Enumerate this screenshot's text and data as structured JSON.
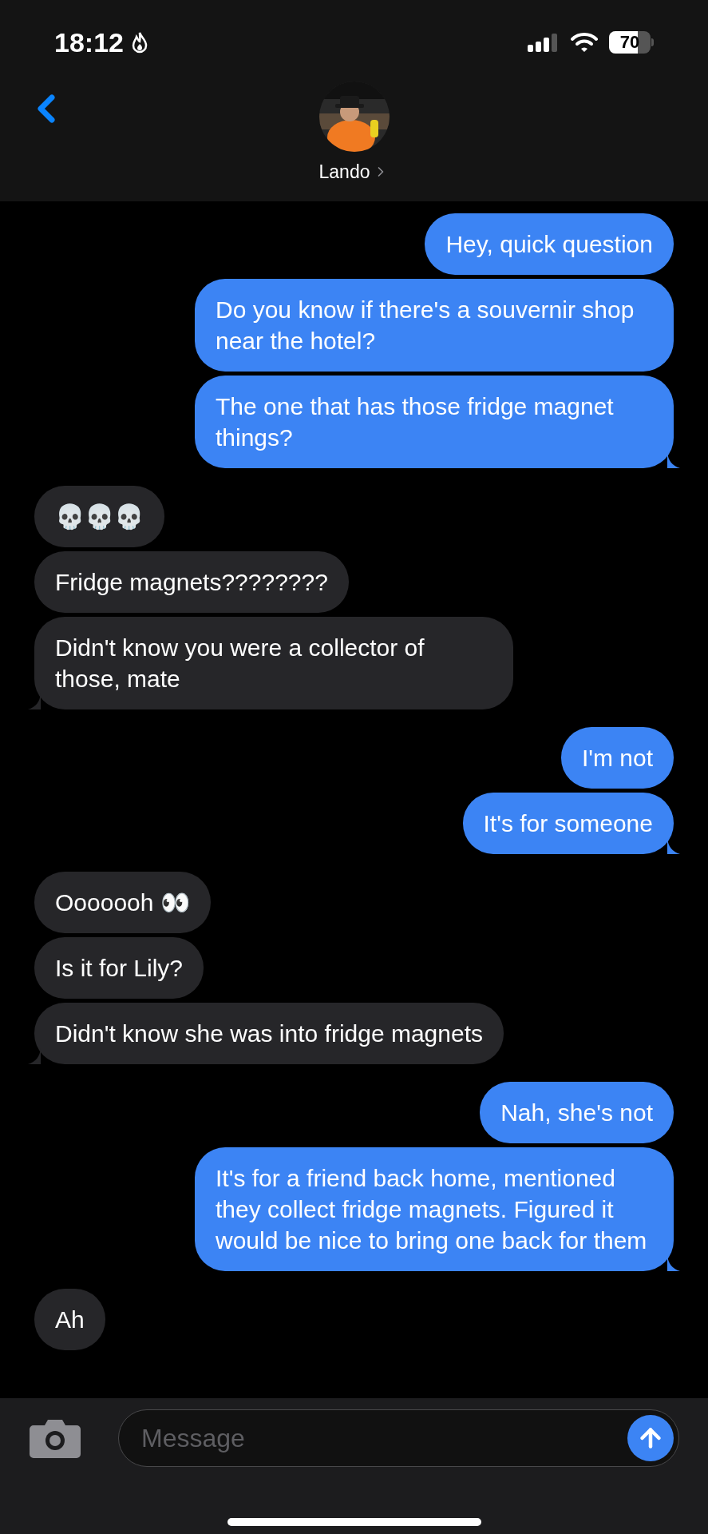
{
  "status_bar": {
    "time": "18:12",
    "battery": "70"
  },
  "header": {
    "contact_name": "Lando"
  },
  "messages": [
    {
      "kind": "sent",
      "text": "Hey, quick question"
    },
    {
      "kind": "sent",
      "text": "Do you know if there's a souvernir shop near the hotel?"
    },
    {
      "kind": "sent",
      "text": "The one that has those fridge magnet things?"
    },
    {
      "kind": "received",
      "text": "💀💀💀"
    },
    {
      "kind": "received",
      "text": "Fridge magnets????????"
    },
    {
      "kind": "received",
      "text": "Didn't know you were a collector of those, mate"
    },
    {
      "kind": "sent",
      "text": "I'm not"
    },
    {
      "kind": "sent",
      "text": "It's for someone"
    },
    {
      "kind": "received",
      "text": "Ooooooh 👀"
    },
    {
      "kind": "received",
      "text": "Is it for Lily?"
    },
    {
      "kind": "received",
      "text": "Didn't know she was into fridge magnets"
    },
    {
      "kind": "sent",
      "text": "Nah, she's not"
    },
    {
      "kind": "sent",
      "text": "It's for a friend back home, mentioned they collect fridge magnets. Figured it would be nice to bring one back for them"
    },
    {
      "kind": "received",
      "text": "Ah"
    }
  ],
  "composer": {
    "placeholder": "Message"
  }
}
